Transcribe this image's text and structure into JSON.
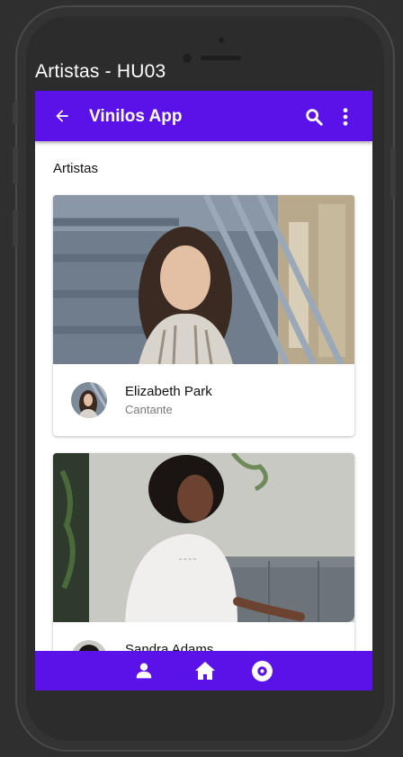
{
  "device": {
    "screen_title": "Artistas - HU03"
  },
  "appbar": {
    "title": "Vinilos App",
    "back_icon": "arrow-left-icon",
    "search_icon": "search-icon",
    "menu_icon": "more-vert-icon"
  },
  "section": {
    "title": "Artistas"
  },
  "artists": [
    {
      "name": "Elizabeth Park",
      "role": "Cantante"
    },
    {
      "name": "Sandra Adams",
      "role": ""
    }
  ],
  "bottom_nav": {
    "icons": [
      "person-icon",
      "home-icon",
      "album-icon"
    ]
  },
  "colors": {
    "primary": "#5b12e8",
    "background": "#ffffff",
    "device": "#2c2c2c"
  }
}
